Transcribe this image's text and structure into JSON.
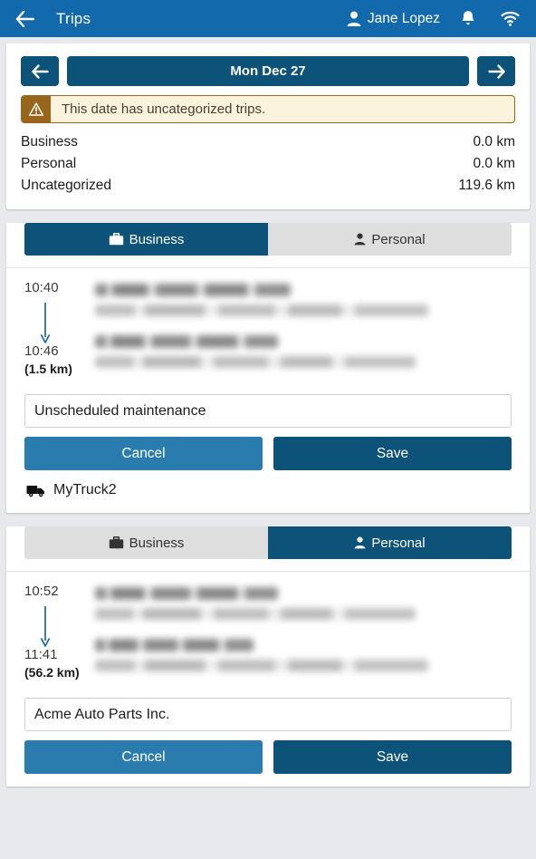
{
  "appbar": {
    "back_icon": "arrow-left-icon",
    "title": "Trips",
    "user_name": "Jane Lopez",
    "user_icon": "person-icon",
    "bell_icon": "bell-icon",
    "wifi_icon": "wifi-icon",
    "background": "#1269ab"
  },
  "date_nav": {
    "prev_icon": "arrow-left-icon",
    "next_icon": "arrow-right-icon",
    "date_label": "Mon Dec 27",
    "button_color": "#0d5278"
  },
  "warning": {
    "icon": "warning-triangle-icon",
    "message": "This date has uncategorized trips.",
    "icon_bg": "#97661c",
    "banner_bg": "#fcf3dd"
  },
  "summary": {
    "rows": [
      {
        "label": "Business",
        "value": "0.0 km"
      },
      {
        "label": "Personal",
        "value": "0.0 km"
      },
      {
        "label": "Uncategorized",
        "value": "119.6 km"
      }
    ]
  },
  "tab_labels": {
    "business": "Business",
    "personal": "Personal",
    "business_icon": "briefcase-icon",
    "personal_icon": "person-icon"
  },
  "trips": [
    {
      "selected_tab": "business",
      "start_time": "10:40",
      "end_time": "10:46",
      "distance": "(1.5 km)",
      "note_value": "Unscheduled maintenance",
      "note_placeholder": "",
      "cancel_label": "Cancel",
      "save_label": "Save",
      "vehicle_name": "MyTruck2",
      "vehicle_icon": "truck-icon",
      "start_address_redacted": true,
      "end_address_redacted": true
    },
    {
      "selected_tab": "personal",
      "start_time": "10:52",
      "end_time": "11:41",
      "distance": "(56.2 km)",
      "note_value": "Acme Auto Parts Inc.",
      "note_placeholder": "",
      "cancel_label": "Cancel",
      "save_label": "Save",
      "start_address_redacted": true,
      "end_address_redacted": true
    }
  ],
  "colors": {
    "page_bg": "#e7e9ec",
    "primary_dark": "#0d5278",
    "primary_light": "#2a7cae",
    "appbar": "#1269ab",
    "tab_inactive": "#dedede"
  }
}
